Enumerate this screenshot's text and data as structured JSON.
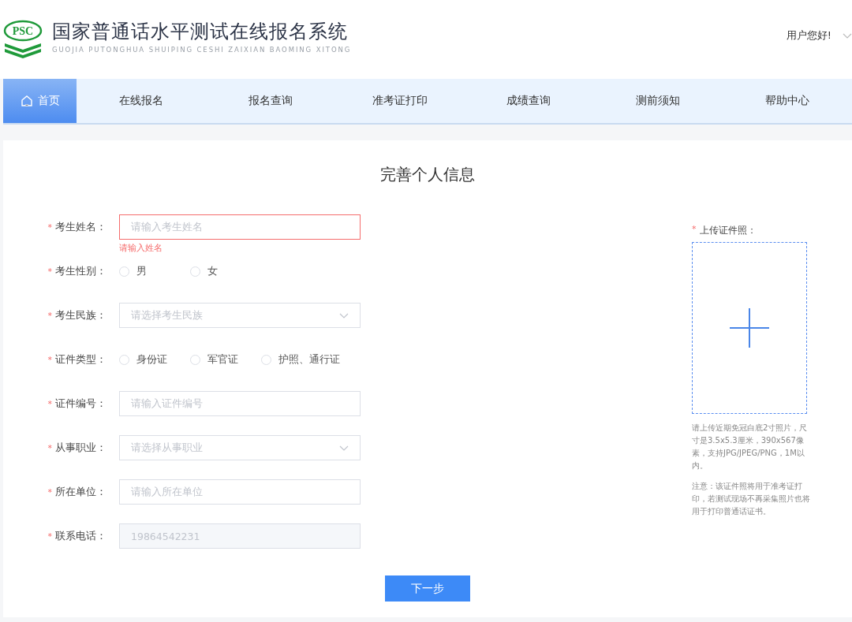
{
  "header": {
    "logo_text": "PSC",
    "title": "国家普通话水平测试在线报名系统",
    "subtitle": "GUOJIA PUTONGHUA SHUIPING CESHI ZAIXIAN BAOMING XITONG",
    "greeting": "用户您好!"
  },
  "nav": [
    {
      "label": "首页",
      "selected": true
    },
    {
      "label": "在线报名",
      "selected": false
    },
    {
      "label": "报名查询",
      "selected": false
    },
    {
      "label": "准考证打印",
      "selected": false
    },
    {
      "label": "成绩查询",
      "selected": false
    },
    {
      "label": "测前须知",
      "selected": false
    },
    {
      "label": "帮助中心",
      "selected": false
    }
  ],
  "form": {
    "title": "完善个人信息",
    "fields": [
      {
        "kind": "input",
        "mark": "*",
        "label": "考生姓名：",
        "placeholder": "请输入考生姓名",
        "error": "请输入姓名"
      },
      {
        "kind": "radio",
        "mark": "*",
        "label": "考生性别：",
        "options": [
          {
            "label": "男",
            "selected": false
          },
          {
            "label": "女",
            "selected": false
          }
        ]
      },
      {
        "kind": "select",
        "mark": "*",
        "label": "考生民族：",
        "placeholder": "请选择考生民族"
      },
      {
        "kind": "radio",
        "mark": "*",
        "label": "证件类型：",
        "options": [
          {
            "label": "身份证",
            "selected": false
          },
          {
            "label": "军官证",
            "selected": false
          },
          {
            "label": "护照、通行证",
            "selected": false
          }
        ]
      },
      {
        "kind": "input",
        "mark": "*",
        "label": "证件编号：",
        "placeholder": "请输入证件编号"
      },
      {
        "kind": "select",
        "mark": "*",
        "label": "从事职业：",
        "placeholder": "请选择从事职业"
      },
      {
        "kind": "input",
        "mark": "*",
        "label": "所在单位：",
        "placeholder": "请输入所在单位"
      },
      {
        "kind": "input",
        "mark": "*",
        "label": "联系电话：",
        "value": "19864542231",
        "disabled": true
      }
    ],
    "upload": {
      "mark": "*",
      "label": "上传证件照：",
      "notes": [
        "请上传近期免冠白底2寸照片，尺寸是3.5x5.3厘米，390x567像素，支持JPG/JPEG/PNG，1M以内。",
        "注意：该证件照将用于准考证打印，若测试现场不再采集照片也将用于打印普通话证书。"
      ]
    },
    "submit": "下一步"
  }
}
